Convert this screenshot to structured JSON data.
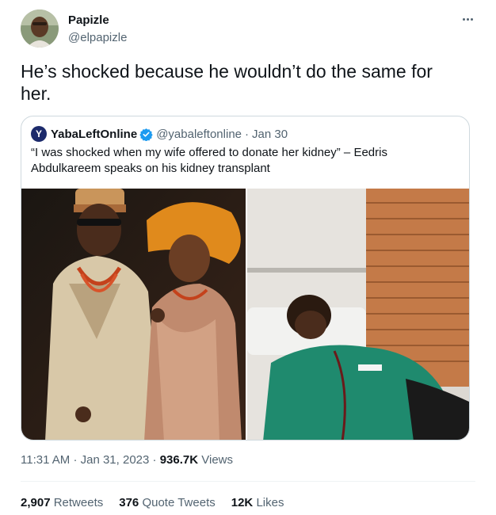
{
  "author": {
    "display_name": "Papizle",
    "handle": "@elpapizle"
  },
  "tweet": {
    "text": "He’s shocked because he wouldn’t do the same for her."
  },
  "more_icon": "more-horizontal-icon",
  "quote": {
    "avatar_letter": "Y",
    "display_name": "YabaLeftOnline",
    "verified_icon": "verified-badge-icon",
    "handle": "@yabaleftonline",
    "separator": "·",
    "date": "Jan 30",
    "text": "“I was shocked when my wife offered to donate her kidney” – Eedris Abdulkareem speaks on his kidney transplant",
    "brand_color": "#1c2a6b"
  },
  "meta": {
    "time": "11:31 AM",
    "sep1": "·",
    "date": "Jan 31, 2023",
    "sep2": "·",
    "views_count": "936.7K",
    "views_label": "Views"
  },
  "stats": [
    {
      "count": "2,907",
      "label": "Retweets"
    },
    {
      "count": "376",
      "label": "Quote Tweets"
    },
    {
      "count": "12K",
      "label": "Likes"
    }
  ],
  "colors": {
    "accent": "#1d9bf0",
    "text": "#0f1419",
    "muted": "#536471",
    "border": "#cfd9de"
  }
}
